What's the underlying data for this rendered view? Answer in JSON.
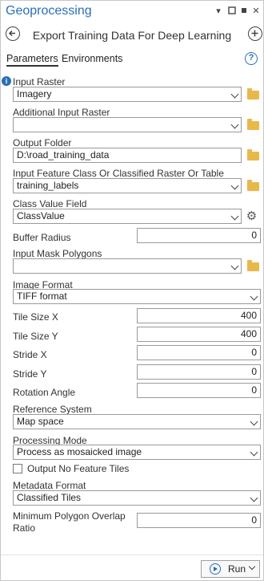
{
  "window": {
    "title": "Geoprocessing"
  },
  "header": {
    "tool_title": "Export Training Data For Deep Learning"
  },
  "tabs": [
    {
      "label": "Parameters",
      "active": true
    },
    {
      "label": "Environments",
      "active": false
    }
  ],
  "params": {
    "input_raster": {
      "label": "Input Raster",
      "value": "Imagery"
    },
    "additional_input_raster": {
      "label": "Additional Input Raster",
      "value": ""
    },
    "output_folder": {
      "label": "Output Folder",
      "value": "D:\\road_training_data"
    },
    "input_feature_class": {
      "label": "Input Feature Class Or Classified Raster Or Table",
      "value": "training_labels"
    },
    "class_value_field": {
      "label": "Class Value Field",
      "value": "ClassValue"
    },
    "buffer_radius": {
      "label": "Buffer Radius",
      "value": "0"
    },
    "input_mask_polygons": {
      "label": "Input Mask Polygons",
      "value": ""
    },
    "image_format": {
      "label": "Image Format",
      "value": "TIFF format"
    },
    "tile_size_x": {
      "label": "Tile Size X",
      "value": "400"
    },
    "tile_size_y": {
      "label": "Tile Size Y",
      "value": "400"
    },
    "stride_x": {
      "label": "Stride X",
      "value": "0"
    },
    "stride_y": {
      "label": "Stride Y",
      "value": "0"
    },
    "rotation_angle": {
      "label": "Rotation Angle",
      "value": "0"
    },
    "reference_system": {
      "label": "Reference System",
      "value": "Map space"
    },
    "processing_mode": {
      "label": "Processing Mode",
      "value": "Process as mosaicked image"
    },
    "output_no_feature_tiles": {
      "label": "Output No Feature Tiles",
      "checked": false
    },
    "metadata_format": {
      "label": "Metadata Format",
      "value": "Classified Tiles"
    },
    "min_polygon_overlap_ratio": {
      "label_line1": "Minimum Polygon Overlap",
      "label_line2": "Ratio",
      "value": "0"
    }
  },
  "footer": {
    "run_label": "Run"
  },
  "colors": {
    "accent": "#2a6fb8",
    "folder": "#e8b84a"
  },
  "icons": [
    "back-icon",
    "add-icon",
    "help-icon",
    "info-icon",
    "folder-icon",
    "gear-icon",
    "play-icon"
  ]
}
